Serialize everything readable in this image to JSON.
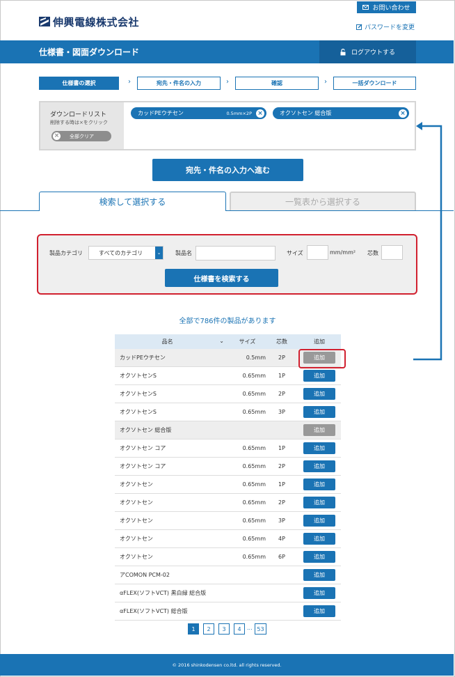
{
  "header": {
    "company_name": "伸興電線株式会社",
    "contact_label": "お問い合わせ",
    "password_label": "パスワードを変更",
    "page_title": "仕様書・図面ダウンロード",
    "logout_label": "ログアウトする"
  },
  "steps": [
    {
      "label": "仕様書の選択",
      "active": true
    },
    {
      "label": "宛先・件名の入力",
      "active": false
    },
    {
      "label": "確認",
      "active": false
    },
    {
      "label": "一括ダウンロード",
      "active": false
    }
  ],
  "download_list": {
    "title": "ダウンロードリスト",
    "subtitle": "削除する時は×をクリック",
    "clear_label": "全部クリア",
    "items": [
      {
        "name": "カッドPEウチセン",
        "size": "0.5mm×2P"
      },
      {
        "name": "オクソトセン 総合版",
        "size": ""
      }
    ]
  },
  "proceed_label": "宛先・件名の入力へ進む",
  "tabs": {
    "search": "検索して選択する",
    "list": "一覧表から選択する"
  },
  "search": {
    "category_label": "製品カテゴリ",
    "category_value": "すべてのカテゴリ",
    "name_label": "製品名",
    "size_label": "サイズ",
    "size_unit": "mm/mm²",
    "core_label": "芯数",
    "button_label": "仕様書を検索する"
  },
  "result_count": "全部で786件の製品があります",
  "table": {
    "headers": {
      "name": "品名",
      "size": "サイズ",
      "core": "芯数",
      "add": "追加"
    },
    "add_label": "追加",
    "rows": [
      {
        "name": "カッドPEウチセン",
        "size": "0.5mm",
        "core": "2P",
        "added": true
      },
      {
        "name": "オクソトセンS",
        "size": "0.65mm",
        "core": "1P",
        "added": false
      },
      {
        "name": "オクソトセンS",
        "size": "0.65mm",
        "core": "2P",
        "added": false
      },
      {
        "name": "オクソトセンS",
        "size": "0.65mm",
        "core": "3P",
        "added": false
      },
      {
        "name": "オクソトセン 総合版",
        "size": "",
        "core": "",
        "added": true
      },
      {
        "name": "オクソトセン コア",
        "size": "0.65mm",
        "core": "1P",
        "added": false
      },
      {
        "name": "オクソトセン コア",
        "size": "0.65mm",
        "core": "2P",
        "added": false
      },
      {
        "name": "オクソトセン",
        "size": "0.65mm",
        "core": "1P",
        "added": false
      },
      {
        "name": "オクソトセン",
        "size": "0.65mm",
        "core": "2P",
        "added": false
      },
      {
        "name": "オクソトセン",
        "size": "0.65mm",
        "core": "3P",
        "added": false
      },
      {
        "name": "オクソトセン",
        "size": "0.65mm",
        "core": "4P",
        "added": false
      },
      {
        "name": "オクソトセン",
        "size": "0.65mm",
        "core": "6P",
        "added": false
      },
      {
        "name": "アCOMON PCM-02",
        "size": "",
        "core": "",
        "added": false
      },
      {
        "name": "αFLEX(ソフトVCT) 黒白緑 総合版",
        "size": "",
        "core": "",
        "added": false
      },
      {
        "name": "αFLEX(ソフトVCT) 総合版",
        "size": "",
        "core": "",
        "added": false
      }
    ]
  },
  "pagination": {
    "pages": [
      "1",
      "2",
      "3",
      "4"
    ],
    "ellipsis": "...",
    "last": "53",
    "current": "1"
  },
  "footer": "© 2016 shinkodensen co.ltd. all rights reserved.",
  "colors": {
    "primary": "#1a73b4",
    "highlight": "#d1202f",
    "added": "#999999"
  }
}
